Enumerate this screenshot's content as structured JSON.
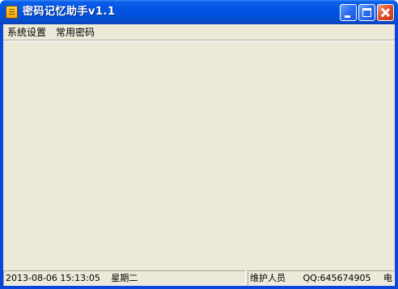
{
  "window": {
    "title": "密码记忆助手v1.1"
  },
  "menu": {
    "items": [
      {
        "label": "系统设置"
      },
      {
        "label": "常用密码"
      }
    ]
  },
  "status": {
    "datetime": "2013-08-06 15:13:05",
    "weekday": "星期二",
    "maintainer": "维护人员",
    "qq": "QQ:645674905",
    "more": "电"
  },
  "colors": {
    "titlebar": "#0055e5",
    "client": "#ece9d8",
    "close_button": "#e0502a"
  },
  "icons": {
    "app": "app-icon",
    "minimize": "minimize-icon",
    "maximize": "maximize-icon",
    "close": "close-icon"
  }
}
